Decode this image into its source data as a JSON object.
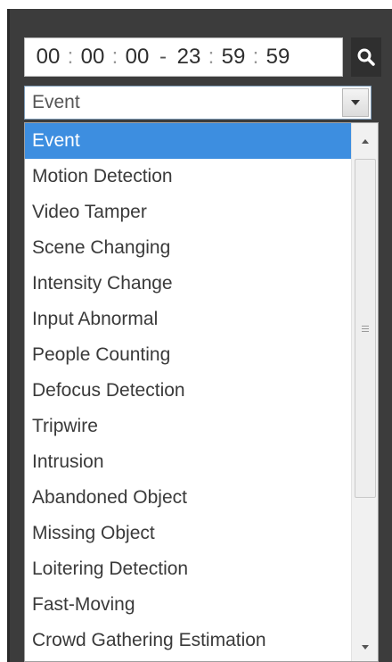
{
  "time_range": {
    "start_hour": "00",
    "start_minute": "00",
    "start_second": "00",
    "separator": "-",
    "end_hour": "23",
    "end_minute": "59",
    "end_second": "59",
    "colon": ":"
  },
  "search_button": {
    "icon": "search-icon"
  },
  "type_select": {
    "value": "Event",
    "arrow_icon": "chevron-down-icon"
  },
  "dropdown": {
    "selected_index": 0,
    "options": [
      "Event",
      "Motion Detection",
      "Video Tamper",
      "Scene Changing",
      "Intensity Change",
      "Input Abnormal",
      "People Counting",
      "Defocus Detection",
      "Tripwire",
      "Intrusion",
      "Abandoned Object",
      "Missing Object",
      "Loitering Detection",
      "Fast-Moving",
      "Crowd Gathering Estimation"
    ]
  },
  "colors": {
    "selection": "#3d8ee0",
    "panel": "#3c3c3c"
  }
}
